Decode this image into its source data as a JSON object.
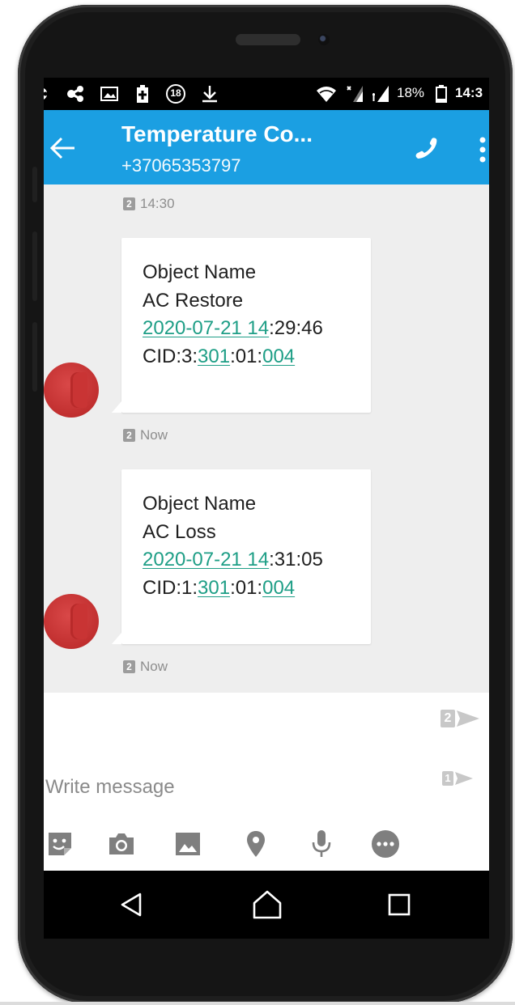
{
  "status_bar": {
    "notification_badge": "18",
    "battery": "18%",
    "time": "14:3"
  },
  "app_bar": {
    "title": "Temperature Co...",
    "subtitle": "+37065353797",
    "accent_color": "#1b9fe2"
  },
  "conversation": {
    "messages": [
      {
        "sim": "2",
        "time": "14:30",
        "lines": [
          "Object Name",
          "AC Restore"
        ],
        "date_link": "2020-07-21 14",
        "date_rest": ":29:46",
        "cid_prefix": "CID:3:",
        "cid_link1": "301",
        "cid_mid": ":01:",
        "cid_link2": "004",
        "status_sim": "2",
        "status": "Now"
      },
      {
        "lines": [
          "Object Name",
          "AC Loss"
        ],
        "date_link": "2020-07-21 14",
        "date_rest": ":31:05",
        "cid_prefix": "CID:1:",
        "cid_link1": "301",
        "cid_mid": ":01:",
        "cid_link2": "004",
        "status_sim": "2",
        "status": "Now"
      }
    ]
  },
  "composer": {
    "placeholder": "Write message",
    "send_sim2": "2",
    "send_sim1": "1",
    "tools": [
      "sticker-icon",
      "camera-icon",
      "gallery-icon",
      "location-icon",
      "microphone-icon",
      "more-options-icon"
    ]
  },
  "nav": {
    "items": [
      "back-icon",
      "home-icon",
      "recents-icon"
    ]
  }
}
